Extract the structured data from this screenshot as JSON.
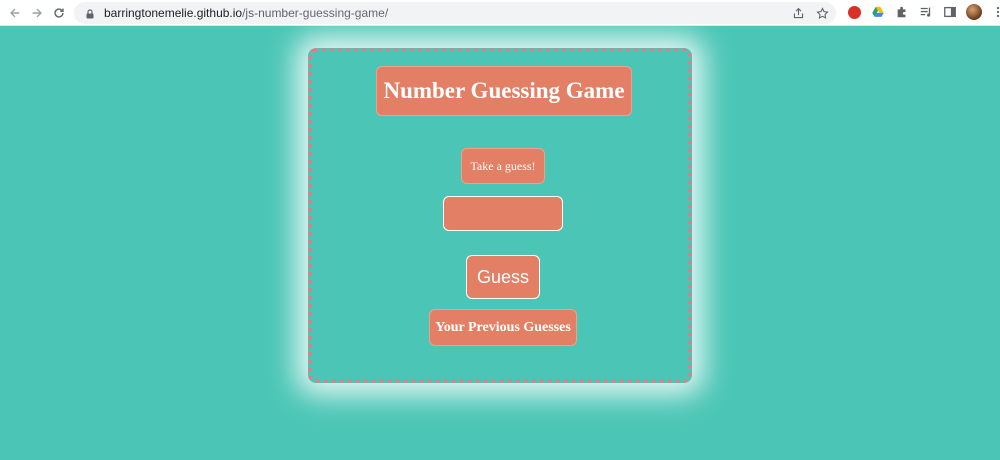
{
  "browser": {
    "url_host": "barringtonemelie.github.io",
    "url_path": "/js-number-guessing-game/",
    "nav_icons": [
      "back-arrow-icon",
      "forward-arrow-icon",
      "reload-icon"
    ],
    "omnibox_icons": [
      "lock-icon",
      "share-icon",
      "bookmark-star-icon"
    ],
    "extension_icons": [
      "red-extension-icon",
      "google-drive-icon",
      "puzzle-extensions-icon",
      "media-playlist-icon",
      "side-panel-icon",
      "profile-avatar",
      "kebab-menu-icon"
    ]
  },
  "game": {
    "title": "Number Guessing Game",
    "prompt": "Take a guess!",
    "input_value": "",
    "guess_button": "Guess",
    "previous_guesses_label": "Your Previous Guesses"
  },
  "colors": {
    "background": "#4bc6b6",
    "box": "#e37f64",
    "dotted_border": "#e37c8a",
    "text": "#ffffff"
  }
}
